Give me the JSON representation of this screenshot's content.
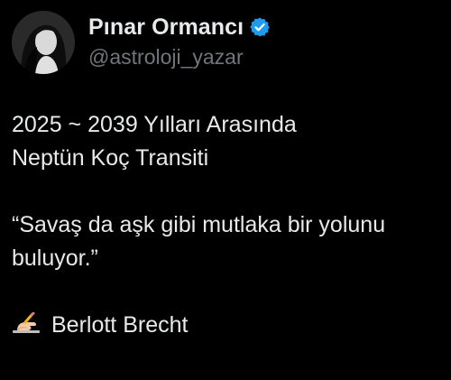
{
  "author": {
    "display_name": "Pınar Ormancı",
    "handle": "@astroloji_yazar",
    "verified": true,
    "avatar_icon": "profile-photo",
    "verified_icon": "verified-badge-icon",
    "verified_color": "#1d9bf0"
  },
  "tweet": {
    "line1": "2025 ~ 2039 Yılları Arasında",
    "line2": "Neptün Koç Transiti",
    "quote_line1": "“Savaş da aşk gibi mutlaka bir yolunu",
    "quote_line2": "buluyor.”",
    "signature_icon": "writing-hand-emoji",
    "signature": "Berlott Brecht"
  },
  "colors": {
    "background": "#000000",
    "text": "#e7e9ea",
    "secondary": "#71767b"
  }
}
